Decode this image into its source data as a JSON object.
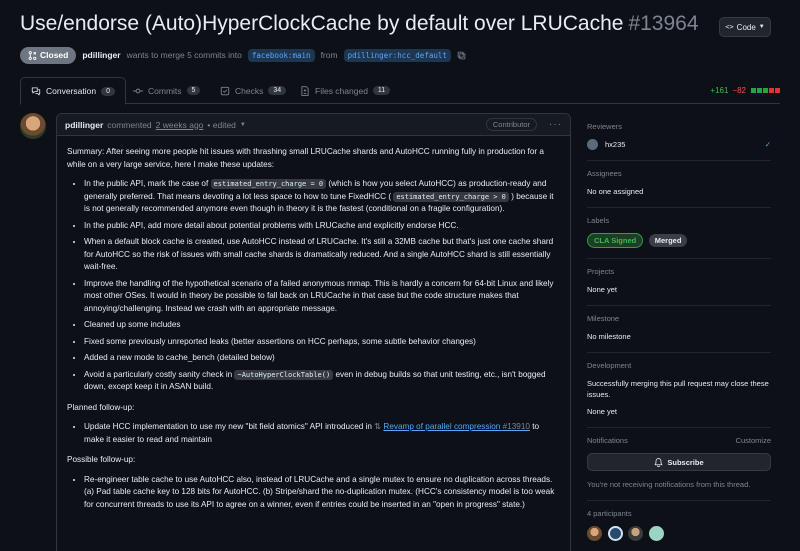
{
  "header": {
    "title": "Use/endorse (Auto)HyperClockCache by default over LRUCache",
    "number": "#13964",
    "code_button": "Code",
    "status": "Closed",
    "author": "pdillinger",
    "merge_text": "wants to merge 5 commits into",
    "base_branch": "facebook:main",
    "from_text": "from",
    "head_branch": "pdillinger:hcc_default"
  },
  "tabs": [
    {
      "label": "Conversation",
      "count": "0"
    },
    {
      "label": "Commits",
      "count": "5"
    },
    {
      "label": "Checks",
      "count": "34"
    },
    {
      "label": "Files changed",
      "count": "11"
    }
  ],
  "diffstat": {
    "additions": "+161",
    "deletions": "−82"
  },
  "comment": {
    "author": "pdillinger",
    "action": "commented",
    "time": "2 weeks ago",
    "edited": "• edited",
    "badge": "Contributor",
    "summary": "Summary: After seeing more people hit issues with thrashing small LRUCache shards and AutoHCC running fully in production for a while on a very large service, here I make these updates:",
    "b1": {
      "t1": "In the public API, mark the case of",
      "c1": "estimated_entry_charge = 0",
      "t2": "(which is how you select AutoHCC) as production-ready and generally preferred. That means devoting a lot less space to how to tune FixedHCC (",
      "c2": "estimated_entry_charge > 0",
      "t3": ") because it is not generally recommended anymore even though in theory it is the fastest (conditional on a fragile configuration)."
    },
    "b2": "In the public API, add more detail about potential problems with LRUCache and explicitly endorse HCC.",
    "b3": "When a default block cache is created, use AutoHCC instead of LRUCache. It's still a 32MB cache but that's just one cache shard for AutoHCC so the risk of issues with small cache shards is dramatically reduced. And a single AutoHCC shard is still essentially wait-free.",
    "b4": "Improve the handling of the hypothetical scenario of a failed anonymous mmap. This is hardly a concern for 64-bit Linux and likely most other OSes. It would in theory be possible to fall back on LRUCache in that case but the code structure makes that annoying/challenging. Instead we crash with an appropriate message.",
    "b5": "Cleaned up some includes",
    "b6": "Fixed some previously unreported leaks (better assertions on HCC perhaps, some subtle behavior changes)",
    "b7": "Added a new mode to cache_bench (detailed below)",
    "b8": {
      "t1": "Avoid a particularly costly sanity check in",
      "c1": "~AutoHyperClockTable()",
      "t2": "even in debug builds so that unit testing, etc., isn't bogged down, except keep it in ASAN build."
    },
    "planned": "Planned follow-up:",
    "p1": {
      "t1": "Update HCC implementation to use my new \"bit field atomics\" API introduced in",
      "link": "Revamp of parallel compression",
      "num": "#13910",
      "t2": "to make it easier to read and maintain"
    },
    "possible": "Possible follow-up:",
    "f1": "Re-engineer table cache to use AutoHCC also, instead of LRUCache and a single mutex to ensure no duplication across threads. (a) Pad table cache key to 128 bits for AutoHCC. (b) Stripe/shard the no-duplication mutex. (HCC's consistency model is too weak for concurrent threads to use its API to agree on a winner, even if entries could be inserted in an \"open in progress\" state.)"
  },
  "sidebar": {
    "reviewers_h": "Reviewers",
    "reviewer": "hx235",
    "assignees_h": "Assignees",
    "assignees_v": "No one assigned",
    "labels_h": "Labels",
    "label1": "CLA Signed",
    "label2": "Merged",
    "projects_h": "Projects",
    "projects_v": "None yet",
    "milestone_h": "Milestone",
    "milestone_v": "No milestone",
    "development_h": "Development",
    "development_v": "Successfully merging this pull request may close these issues.",
    "development_v2": "None yet",
    "notifications_h": "Notifications",
    "customize": "Customize",
    "subscribe": "Subscribe",
    "notif_v": "You're not receiving notifications from this thread.",
    "participants_h": "4 participants"
  },
  "colors": {
    "accent": "#58a6ff",
    "cla": "#2ea043",
    "merged": "#6e7681"
  }
}
